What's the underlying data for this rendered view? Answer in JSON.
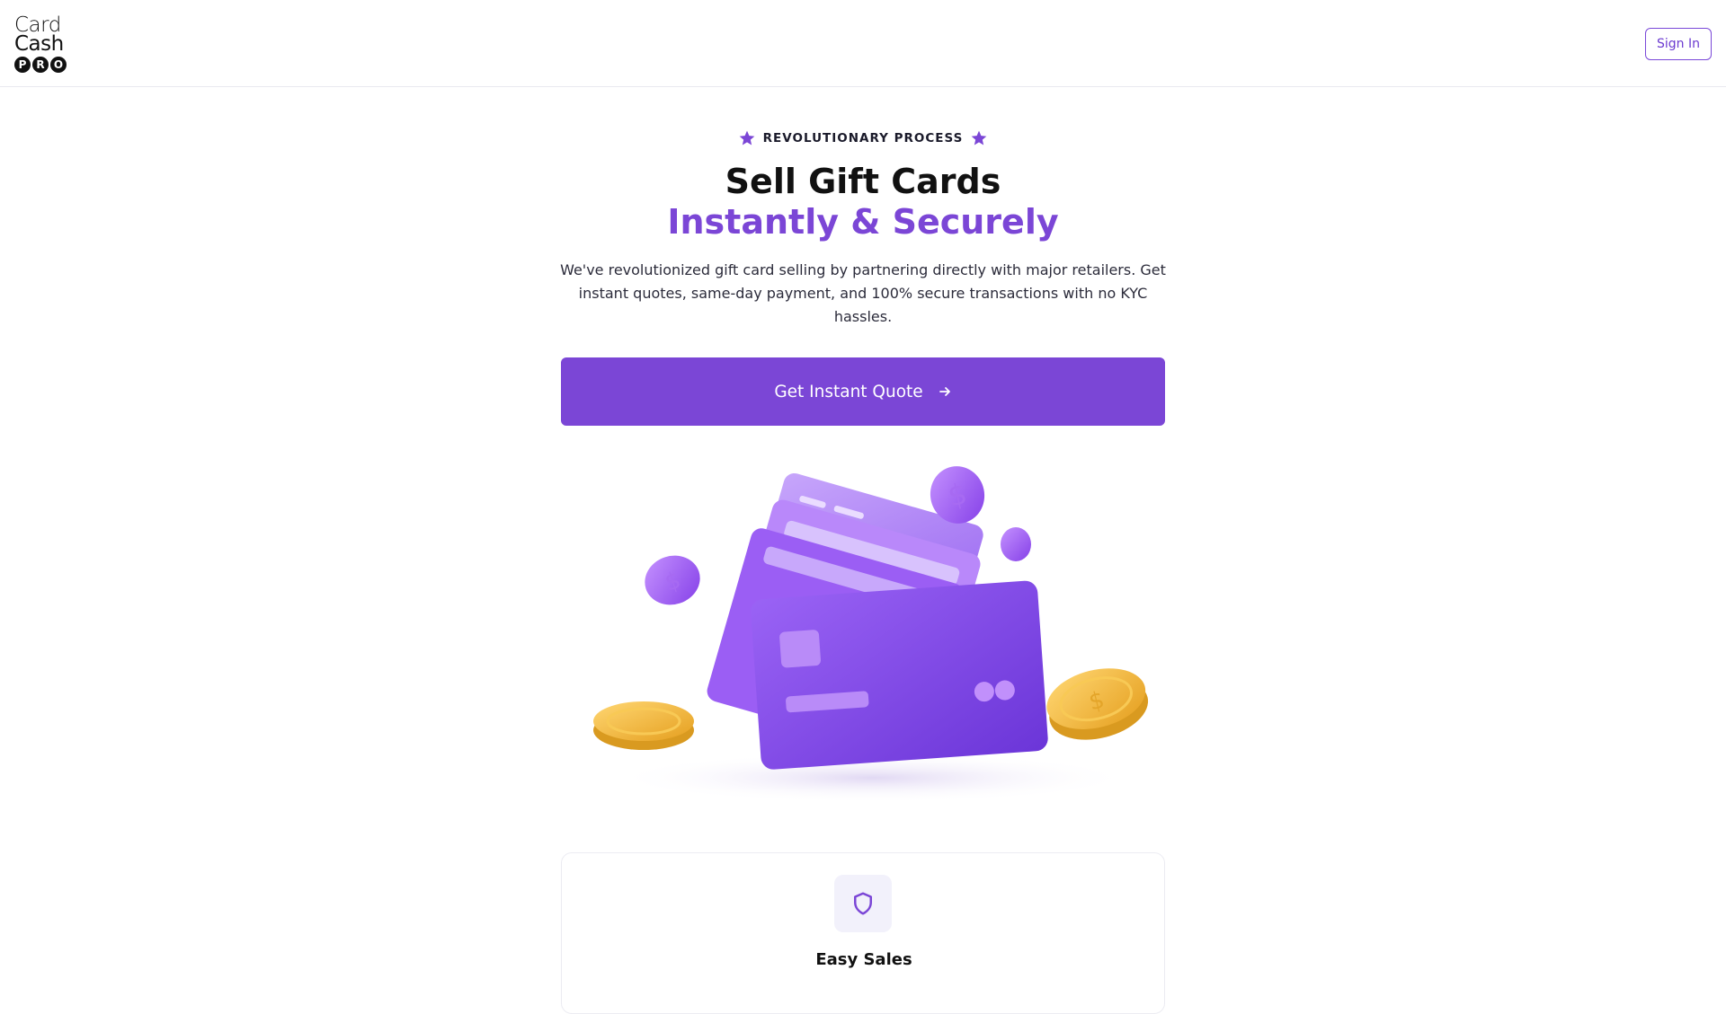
{
  "brand": {
    "line1": "Card",
    "line2": "Cash",
    "pro_letters": [
      "P",
      "R",
      "O"
    ]
  },
  "header": {
    "signin_label": "Sign In"
  },
  "hero": {
    "eyebrow": "REVOLUTIONARY PROCESS",
    "title_line1": "Sell Gift Cards",
    "title_line2": "Instantly & Securely",
    "description": "We've revolutionized gift card selling by partnering directly with major retailers. Get instant quotes, same-day payment, and 100% secure transactions with no KYC hassles.",
    "cta_label": "Get Instant Quote"
  },
  "features": [
    {
      "title": "Easy Sales",
      "icon": "shield-icon"
    }
  ],
  "colors": {
    "accent": "#7b46d6",
    "card_purple": "#8a4ff0",
    "coin_gold": "#f2b93a"
  }
}
